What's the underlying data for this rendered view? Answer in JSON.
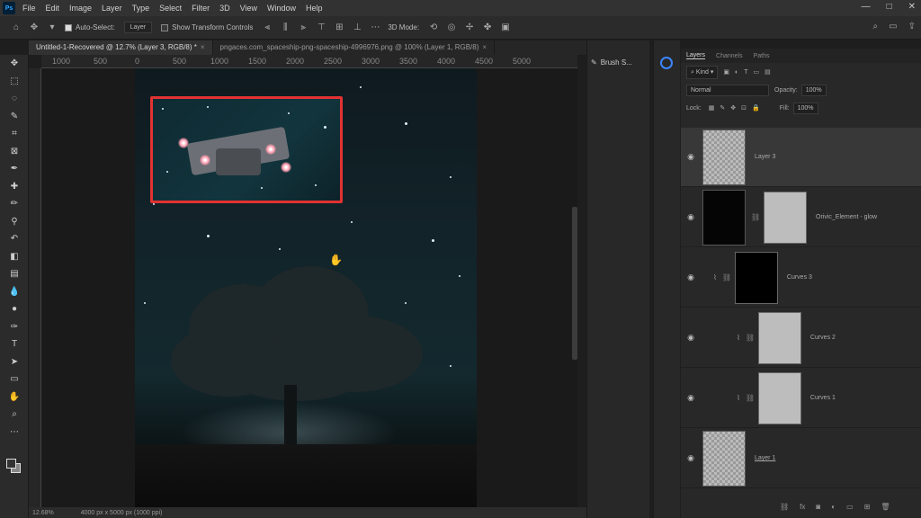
{
  "menu": {
    "logo": "Ps",
    "items": [
      "File",
      "Edit",
      "Image",
      "Layer",
      "Type",
      "Select",
      "Filter",
      "3D",
      "View",
      "Window",
      "Help"
    ],
    "win_controls": [
      "—",
      "□",
      "✕"
    ]
  },
  "options": {
    "auto_select_label": "Auto-Select:",
    "auto_select_value": "Layer",
    "show_transform_label": "Show Transform Controls",
    "mode_3d_label": "3D Mode:"
  },
  "tabs": [
    {
      "label": "Untitled-1-Recovered @ 12.7% (Layer 3, RGB/8) *",
      "close": "×"
    },
    {
      "label": "pngaces.com_spaceship-png-spaceship-4996976.png @ 100% (Layer 1, RGB/8)",
      "close": "×"
    }
  ],
  "ruler": {
    "labels": [
      "1000",
      "500",
      "0",
      "500",
      "1000",
      "1500",
      "2000",
      "2500",
      "3000",
      "3500",
      "4000",
      "4500",
      "5000"
    ]
  },
  "status": {
    "zoom": "12.68%",
    "doc_size": "4000 px x 5000 px (1000 ppi)"
  },
  "midpanel": {
    "brush_label": "Brush S..."
  },
  "layers": {
    "tabs": [
      "Layers",
      "Channels",
      "Paths"
    ],
    "kind_label": "Kind",
    "blend_mode": "Normal",
    "opacity_label": "Opacity:",
    "opacity_value": "100%",
    "lock_label": "Lock:",
    "fill_label": "Fill:",
    "fill_value": "100%",
    "items": [
      {
        "name": "Layer 3"
      },
      {
        "name": "Orivic_Element - glow"
      },
      {
        "name": "Curves 3"
      },
      {
        "name": "Curves 2"
      },
      {
        "name": "Curves 1"
      },
      {
        "name": "Layer 1"
      }
    ],
    "footer_icons": [
      "link-icon",
      "fx-icon",
      "mask-icon",
      "adjustment-icon",
      "folder-icon",
      "new-layer-icon",
      "trash-icon"
    ]
  },
  "colors": {
    "selection_border": "#e23232",
    "accent_blue": "#3b86ff"
  }
}
